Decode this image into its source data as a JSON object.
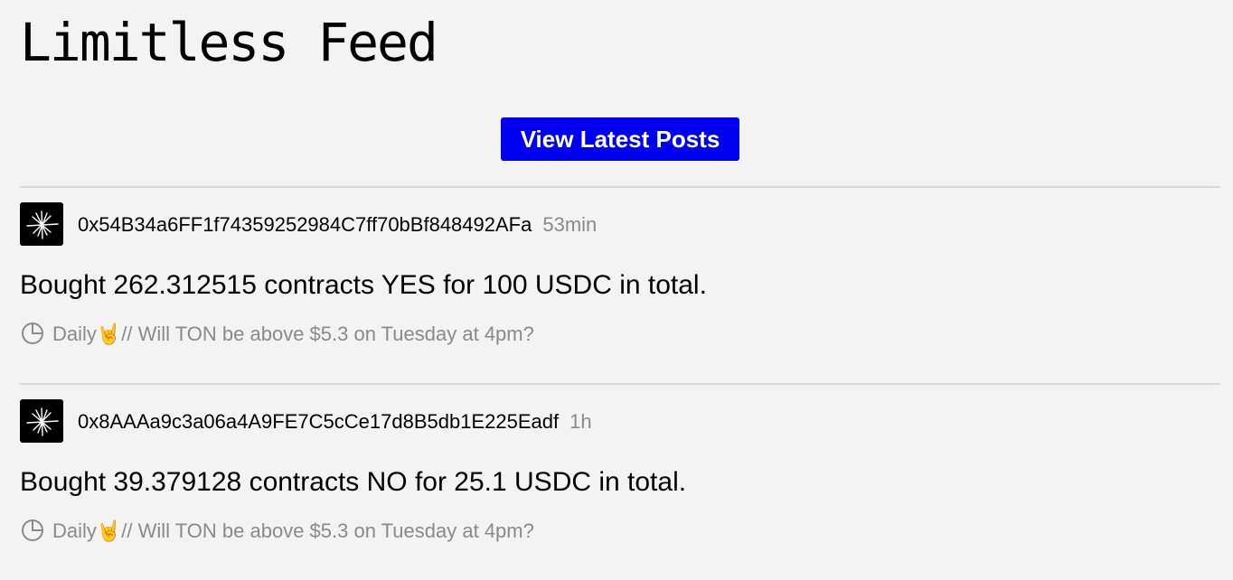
{
  "page": {
    "title": "Limitless Feed",
    "view_button_label": "View Latest Posts"
  },
  "posts": [
    {
      "address": "0x54B34a6FF1f74359252984C7ff70bBf848492AFa",
      "time": "53min",
      "text": "Bought 262.312515 contracts YES for 100 USDC in total.",
      "market": "Daily🤘// Will TON be above $5.3 on Tuesday at 4pm?"
    },
    {
      "address": "0x8AAAa9c3a06a4A9FE7C5cCe17d8B5db1E225Eadf",
      "time": "1h",
      "text": "Bought 39.379128 contracts NO for 25.1 USDC in total.",
      "market": "Daily🤘// Will TON be above $5.3 on Tuesday at 4pm?"
    }
  ],
  "icons": {
    "avatar": "starburst-icon",
    "market": "pie-chart-icon"
  },
  "colors": {
    "accent": "#0000f0",
    "background": "#f3f3f3",
    "muted_text": "#8a8a8a",
    "divider": "#d7d7d7"
  }
}
